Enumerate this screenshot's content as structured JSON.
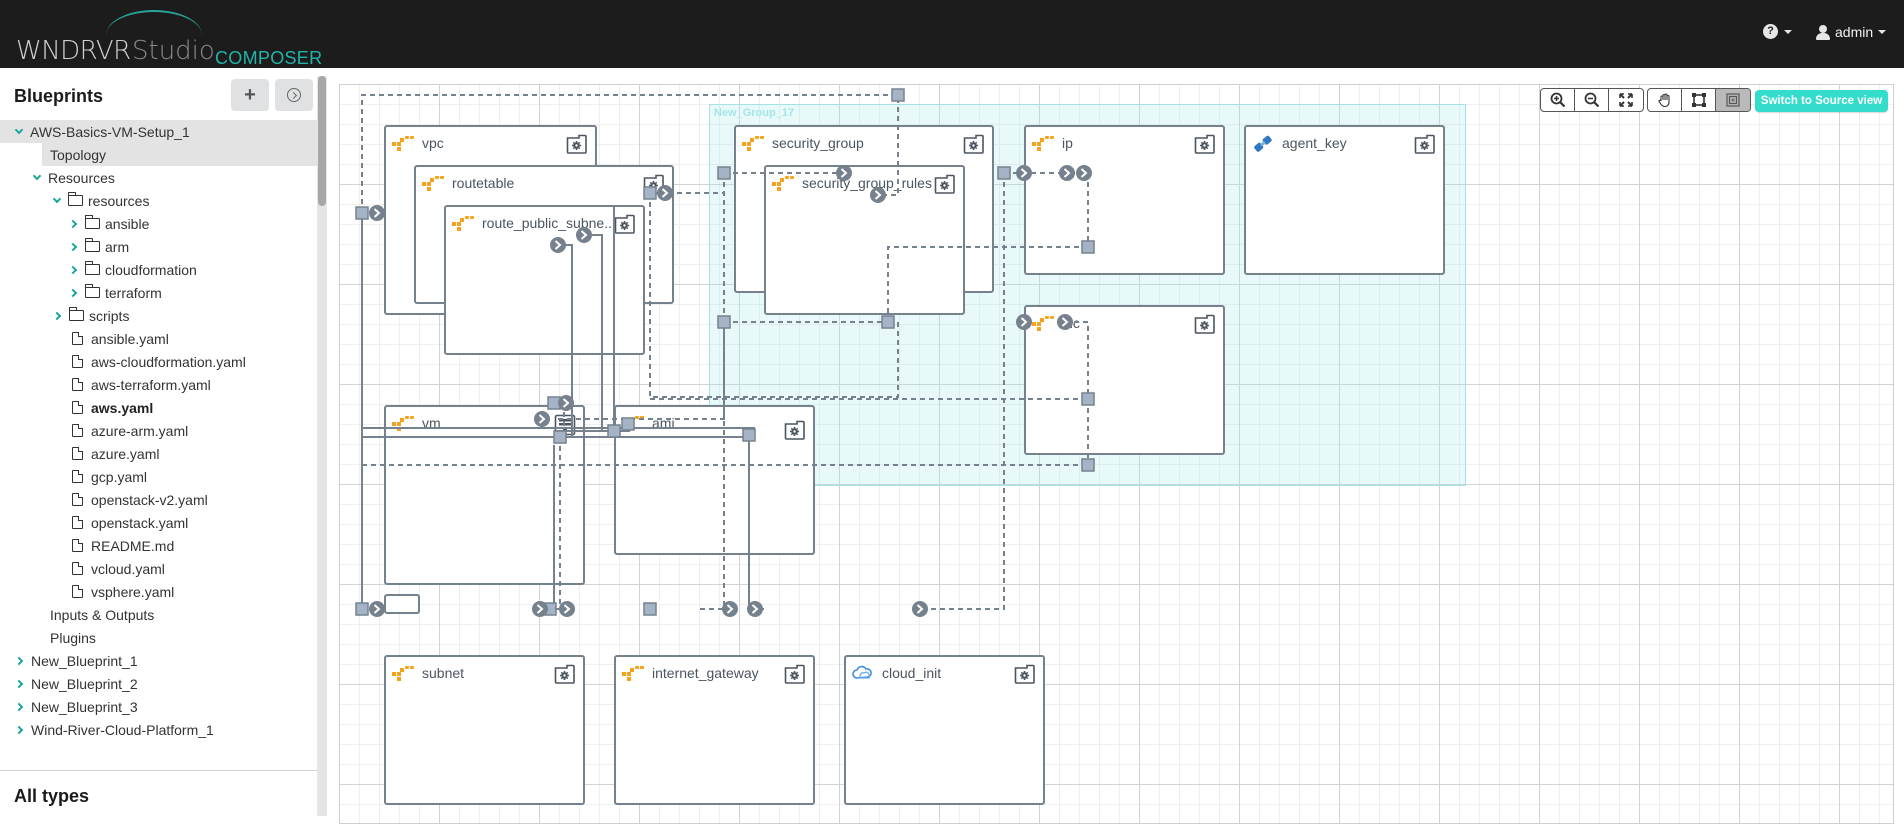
{
  "header": {
    "brand": "WNDRVR",
    "product": "Studio",
    "module": "COMPOSER",
    "help_icon": "question-circle-icon",
    "user": {
      "name": "admin",
      "icon": "user-icon"
    }
  },
  "sidebar": {
    "title": "Blueprints",
    "add_button_icon": "plus-icon",
    "import_button_icon": "arrow-circle-right-icon",
    "tree": [
      {
        "label": "AWS-Basics-VM-Setup_1",
        "depth": 0,
        "type": "blueprint",
        "expander": "down",
        "selected": true
      },
      {
        "label": "Topology",
        "depth": 1,
        "type": "section",
        "expander": "none",
        "selected": true
      },
      {
        "label": "Resources",
        "depth": 1,
        "type": "section",
        "expander": "down"
      },
      {
        "label": "resources",
        "depth": 2,
        "type": "folder",
        "expander": "down"
      },
      {
        "label": "ansible",
        "depth": 3,
        "type": "folder",
        "expander": "right"
      },
      {
        "label": "arm",
        "depth": 3,
        "type": "folder",
        "expander": "right"
      },
      {
        "label": "cloudformation",
        "depth": 3,
        "type": "folder",
        "expander": "right"
      },
      {
        "label": "terraform",
        "depth": 3,
        "type": "folder",
        "expander": "right"
      },
      {
        "label": "scripts",
        "depth": 2,
        "type": "folder",
        "expander": "right"
      },
      {
        "label": "ansible.yaml",
        "depth": 3,
        "type": "file"
      },
      {
        "label": "aws-cloudformation.yaml",
        "depth": 3,
        "type": "file"
      },
      {
        "label": "aws-terraform.yaml",
        "depth": 3,
        "type": "file"
      },
      {
        "label": "aws.yaml",
        "depth": 3,
        "type": "file",
        "bold": true
      },
      {
        "label": "azure-arm.yaml",
        "depth": 3,
        "type": "file"
      },
      {
        "label": "azure.yaml",
        "depth": 3,
        "type": "file"
      },
      {
        "label": "gcp.yaml",
        "depth": 3,
        "type": "file"
      },
      {
        "label": "openstack-v2.yaml",
        "depth": 3,
        "type": "file"
      },
      {
        "label": "openstack.yaml",
        "depth": 3,
        "type": "file"
      },
      {
        "label": "README.md",
        "depth": 3,
        "type": "file"
      },
      {
        "label": "vcloud.yaml",
        "depth": 3,
        "type": "file"
      },
      {
        "label": "vsphere.yaml",
        "depth": 3,
        "type": "file"
      },
      {
        "label": "Inputs & Outputs",
        "depth": 1,
        "type": "section",
        "expander": "none"
      },
      {
        "label": "Plugins",
        "depth": 1,
        "type": "section",
        "expander": "none"
      },
      {
        "label": "New_Blueprint_1",
        "depth": 0,
        "type": "blueprint",
        "expander": "right"
      },
      {
        "label": "New_Blueprint_2",
        "depth": 0,
        "type": "blueprint",
        "expander": "right"
      },
      {
        "label": "New_Blueprint_3",
        "depth": 0,
        "type": "blueprint",
        "expander": "right"
      },
      {
        "label": "Wind-River-Cloud-Platform_1",
        "depth": 0,
        "type": "blueprint",
        "expander": "right"
      }
    ],
    "section2_title": "All types"
  },
  "toolbar": {
    "zoom_in_icon": "zoom-in-icon",
    "zoom_out_icon": "zoom-out-icon",
    "fit_icon": "fit-to-screen-icon",
    "pan_icon": "hand-pan-icon",
    "select_icon": "select-frame-icon",
    "group_icon": "group-select-icon",
    "active_tool": "group-select",
    "switch_view_label": "Switch to Source view"
  },
  "topology": {
    "groups": [
      {
        "name": "New_Group_17"
      }
    ],
    "nodes": [
      {
        "id": "vpc",
        "label": "vpc",
        "icon": "aws-icon",
        "action_icon": "gear-folder-icon"
      },
      {
        "id": "routetable",
        "label": "routetable",
        "icon": "aws-icon",
        "action_icon": "gear-folder-icon",
        "parent": "vpc"
      },
      {
        "id": "route_public_subnet",
        "label": "route_public_subne...",
        "icon": "aws-icon",
        "action_icon": "gear-folder-icon",
        "parent": "routetable"
      },
      {
        "id": "security_group",
        "label": "security_group",
        "icon": "aws-icon",
        "action_icon": "gear-folder-icon",
        "group": "New_Group_17"
      },
      {
        "id": "security_group_rules",
        "label": "security_group_rules",
        "icon": "aws-icon",
        "action_icon": "gear-folder-icon",
        "parent": "security_group"
      },
      {
        "id": "ip",
        "label": "ip",
        "icon": "aws-icon",
        "action_icon": "gear-folder-icon",
        "group": "New_Group_17"
      },
      {
        "id": "agent_key",
        "label": "agent_key",
        "icon": "plug-icon",
        "action_icon": "gear-folder-icon",
        "group": "New_Group_17"
      },
      {
        "id": "nic",
        "label": "nic",
        "icon": "aws-icon",
        "action_icon": "gear-folder-icon",
        "group": "New_Group_17"
      },
      {
        "id": "vm",
        "label": "vm",
        "icon": "aws-icon",
        "action_icon": "server-icon"
      },
      {
        "id": "ami",
        "label": "ami",
        "icon": "aws-icon",
        "action_icon": "gear-folder-icon"
      },
      {
        "id": "subnet",
        "label": "subnet",
        "icon": "aws-icon",
        "action_icon": "gear-folder-icon"
      },
      {
        "id": "internet_gateway",
        "label": "internet_gateway",
        "icon": "aws-icon",
        "action_icon": "gear-folder-icon"
      },
      {
        "id": "cloud_init",
        "label": "cloud_init",
        "icon": "cloud-icon",
        "action_icon": "gear-folder-icon"
      }
    ]
  },
  "colors": {
    "accent": "#21b3aa",
    "button_teal": "#34dccb",
    "node_border": "#76818e",
    "group_fill": "#e8f8f8",
    "aws_orange": "#f7a21b"
  }
}
